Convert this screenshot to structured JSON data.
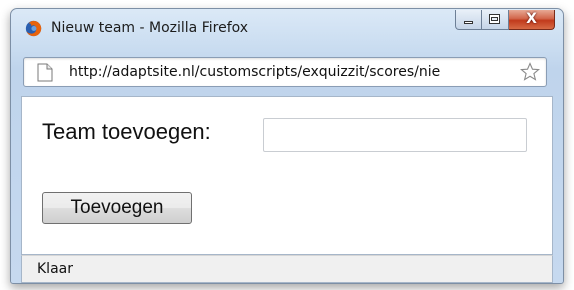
{
  "window": {
    "title": "Nieuw team - Mozilla Firefox",
    "controls": {
      "minimize_icon": "minimize-icon",
      "maximize_icon": "maximize-icon",
      "close_label": "X"
    }
  },
  "urlbar": {
    "url": "http://adaptsite.nl/customscripts/exquizzit/scores/nie",
    "page_icon": "page-icon",
    "bookmark_icon": "star-icon"
  },
  "form": {
    "label": "Team toevoegen:",
    "input_value": "",
    "button_label": "Toevoegen"
  },
  "statusbar": {
    "text": "Klaar"
  },
  "colors": {
    "titlebar": "#c9dcf0",
    "close_button": "#c13a1c",
    "firefox_orange": "#e8630c",
    "firefox_blue": "#2a5fb0"
  }
}
